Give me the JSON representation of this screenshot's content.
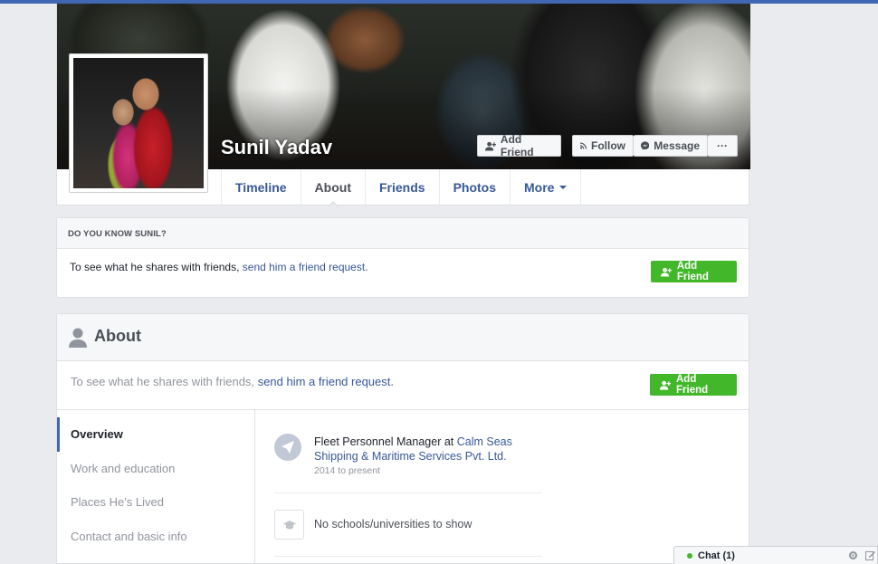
{
  "profile": {
    "name": "Sunil Yadav",
    "cover_buttons": {
      "add_friend": "Add Friend",
      "follow": "Follow",
      "message": "Message",
      "more": "···"
    },
    "tabs": [
      {
        "label": "Timeline"
      },
      {
        "label": "About"
      },
      {
        "label": "Friends"
      },
      {
        "label": "Photos"
      },
      {
        "label": "More"
      }
    ]
  },
  "know_box": {
    "heading": "DO YOU KNOW SUNIL?",
    "text": "To see what he shares with friends,",
    "link": "send him a friend request.",
    "button": "Add Friend"
  },
  "about": {
    "title": "About",
    "request_text": "To see what he shares with friends,",
    "request_link": "send him a friend request.",
    "button": "Add Friend",
    "sidebar": [
      {
        "label": "Overview"
      },
      {
        "label": "Work and education"
      },
      {
        "label": "Places He's Lived"
      },
      {
        "label": "Contact and basic info"
      }
    ],
    "work": {
      "role": "Fleet Personnel Manager at",
      "company": "Calm Seas Shipping & Maritime Services Pvt. Ltd.",
      "period": "2014 to present"
    },
    "school": "No schools/universities to show"
  },
  "chat": {
    "label": "Chat (1)"
  },
  "colors": {
    "brand": "#4267b2",
    "link": "#365899",
    "green": "#42b72a"
  }
}
